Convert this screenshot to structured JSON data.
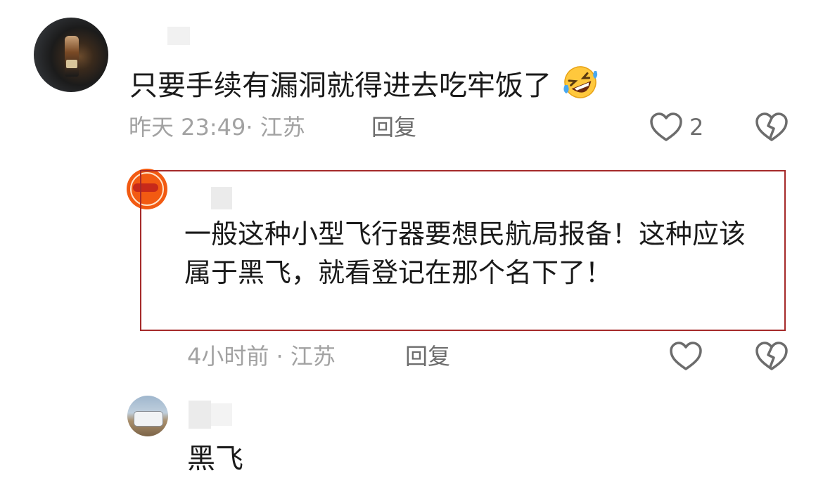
{
  "comments": [
    {
      "text": "只要手续有漏洞就得进去吃牢饭了",
      "emoji": "rolling-on-floor-laughing-emoji",
      "time_location": "昨天 23:49· 江苏",
      "reply_label": "回复",
      "like_count": "2"
    },
    {
      "text": "一般这种小型飞行器要想民航局报备！这种应该属于黑飞，就看登记在那个名下了！",
      "time_location": "4小时前 · 江苏",
      "reply_label": "回复"
    },
    {
      "text": "黑飞"
    }
  ],
  "colors": {
    "highlight_border": "#a52a2a",
    "meta_text": "#a2a2a2",
    "reply_text": "#6c6c6c"
  }
}
